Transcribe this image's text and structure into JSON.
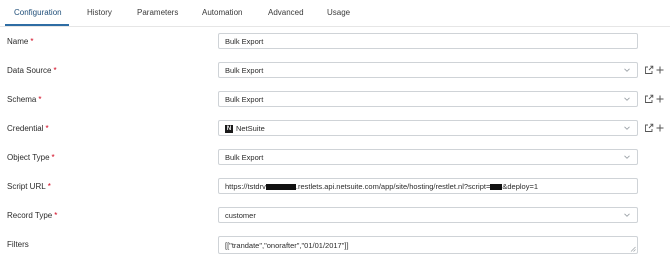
{
  "tabs": [
    {
      "label": "Configuration",
      "active": true
    },
    {
      "label": "History"
    },
    {
      "label": "Parameters"
    },
    {
      "label": "Automation"
    },
    {
      "label": "Advanced"
    },
    {
      "label": "Usage"
    }
  ],
  "form": {
    "name": {
      "label": "Name",
      "value": "Bulk Export"
    },
    "data_source": {
      "label": "Data Source",
      "value": "Bulk Export"
    },
    "schema": {
      "label": "Schema",
      "value": "Bulk Export"
    },
    "credential": {
      "label": "Credential",
      "value": "NetSuite",
      "logo_letter": "N"
    },
    "object_type": {
      "label": "Object Type",
      "value": "Bulk Export"
    },
    "script_url": {
      "label": "Script URL",
      "value_prefix": "https://tstdrv",
      "value_middle": ".restlets.api.netsuite.com/app/site/hosting/restlet.nl?script=",
      "value_suffix": "&deploy=1"
    },
    "record_type": {
      "label": "Record Type",
      "value": "customer"
    },
    "filters": {
      "label": "Filters",
      "value": "[[\"trandate\",\"onorafter\",\"01/01/2017\"]]"
    }
  },
  "required_marker": "*",
  "icons": {
    "edit": "external-edit-icon",
    "add": "plus-icon",
    "dropdown": "chevron-down-icon"
  },
  "colors": {
    "accent": "#2e6da4",
    "required": "#d0021b",
    "border": "#cfd3d7"
  }
}
